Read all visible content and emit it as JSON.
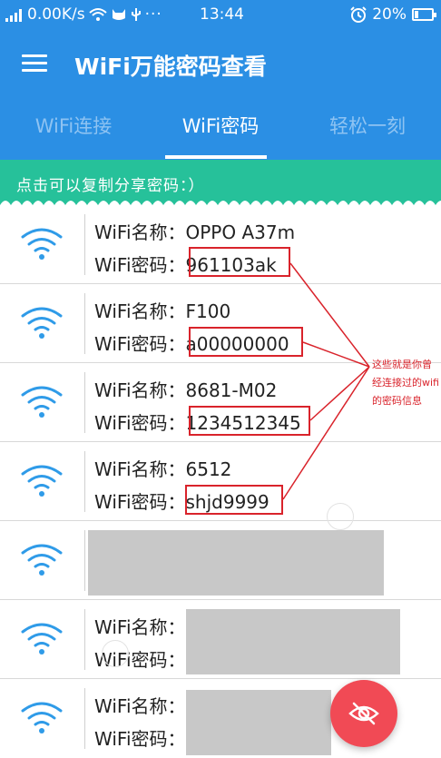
{
  "status_bar": {
    "speed": "0.00K/s",
    "time": "13:44",
    "battery": "20%"
  },
  "app_bar": {
    "title": "WiFi万能密码查看"
  },
  "tabs": [
    {
      "label": "WiFi连接",
      "active": false
    },
    {
      "label": "WiFi密码",
      "active": true
    },
    {
      "label": "轻松一刻",
      "active": false
    }
  ],
  "banner": {
    "text": "点击可以复制分享密码：）"
  },
  "wifi_list": {
    "name_label": "WiFi名称：",
    "password_label": "WiFi密码：",
    "items": [
      {
        "name": "OPPO A37m",
        "password": "961103ak"
      },
      {
        "name": "F100",
        "password": "a00000000"
      },
      {
        "name": "8681-M02",
        "password": "1234512345"
      },
      {
        "name": "6512",
        "password": "shjd9999"
      }
    ]
  },
  "annotation": {
    "text": "这些就是你曾经连接过的wifi的密码信息"
  },
  "colors": {
    "primary": "#2b8fe4",
    "banner": "#26c19a",
    "annotation": "#d9232b",
    "fab": "#f14a55",
    "wifi_icon": "#2f9be8"
  },
  "icons": {
    "menu": "hamburger-menu-icon",
    "wifi": "wifi-icon",
    "fab": "hidden-eye-icon"
  }
}
